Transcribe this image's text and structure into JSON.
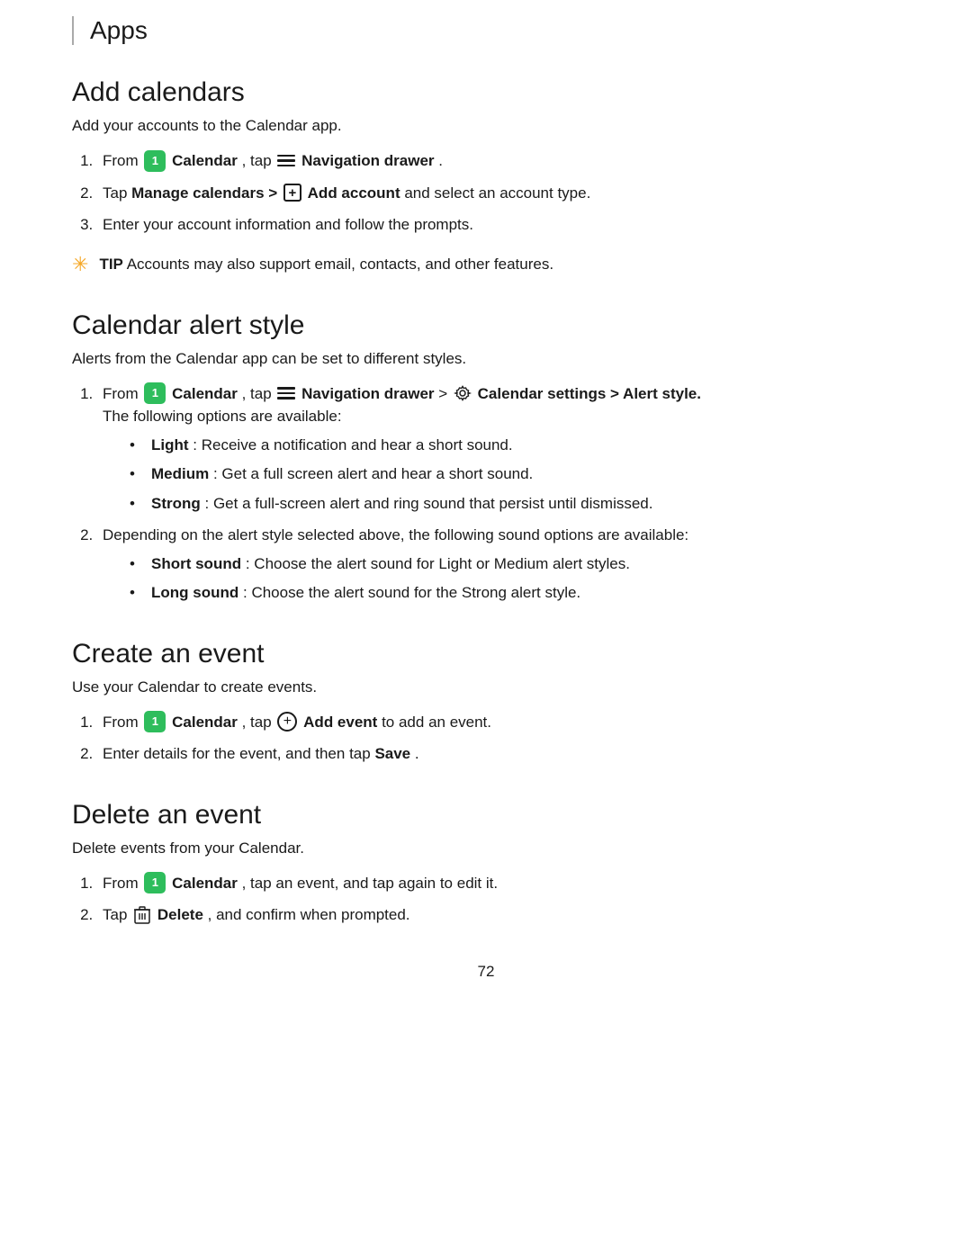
{
  "header": {
    "title": "Apps",
    "border_color": "#aaaaaa"
  },
  "sections": [
    {
      "id": "add-calendars",
      "title": "Add calendars",
      "intro": "Add your accounts to the Calendar app.",
      "steps": [
        {
          "id": "step-1",
          "parts": [
            "From",
            "Calendar",
            "tap",
            "Navigation drawer",
            "."
          ]
        },
        {
          "id": "step-2",
          "parts": [
            "Tap",
            "Manage calendars >",
            "Add account",
            "and select an account type."
          ]
        },
        {
          "id": "step-3",
          "text": "Enter your account information and follow the prompts."
        }
      ],
      "tip": "Accounts may also support email, contacts, and other features."
    },
    {
      "id": "calendar-alert-style",
      "title": "Calendar alert style",
      "intro": "Alerts from the Calendar app can be set to different styles.",
      "steps": [
        {
          "id": "step-1",
          "text_prefix": "From",
          "calendar_label": "Calendar",
          "text_middle": "tap",
          "nav_label": "Navigation drawer",
          "text_arrow": ">",
          "gear_label": "Calendar settings > Alert style.",
          "sub_intro": "The following options are available:",
          "bullets": [
            {
              "bold": "Light",
              "text": ": Receive a notification and hear a short sound."
            },
            {
              "bold": "Medium",
              "text": ": Get a full screen alert and hear a short sound."
            },
            {
              "bold": "Strong",
              "text": ": Get a full-screen alert and ring sound that persist until dismissed."
            }
          ]
        },
        {
          "id": "step-2",
          "text": "Depending on the alert style selected above, the following sound options are available:",
          "bullets": [
            {
              "bold": "Short sound",
              "text": ": Choose the alert sound for Light or Medium alert styles."
            },
            {
              "bold": "Long sound",
              "text": ": Choose the alert sound for the Strong alert style."
            }
          ]
        }
      ]
    },
    {
      "id": "create-an-event",
      "title": "Create an event",
      "intro": "Use your Calendar to create events.",
      "steps": [
        {
          "id": "step-1",
          "parts": [
            "From",
            "Calendar",
            "tap",
            "Add event",
            "to add an event."
          ]
        },
        {
          "id": "step-2",
          "text": "Enter details for the event, and then tap",
          "bold_end": "Save",
          "text_end": "."
        }
      ]
    },
    {
      "id": "delete-an-event",
      "title": "Delete an event",
      "intro": "Delete events from your Calendar.",
      "steps": [
        {
          "id": "step-1",
          "parts": [
            "From",
            "Calendar",
            ", tap an event, and tap again to edit it."
          ]
        },
        {
          "id": "step-2",
          "parts": [
            "Tap",
            "Delete",
            ", and confirm when prompted."
          ]
        }
      ]
    }
  ],
  "page_number": "72",
  "labels": {
    "calendar_icon_text": "1",
    "tip_label": "TIP",
    "navigation_drawer": "Navigation drawer",
    "calendar_settings": "Calendar settings",
    "alert_style": "Alert style",
    "manage_calendars": "Manage calendars",
    "add_account": "Add account",
    "add_event": "Add event",
    "save": "Save",
    "delete": "Delete"
  }
}
